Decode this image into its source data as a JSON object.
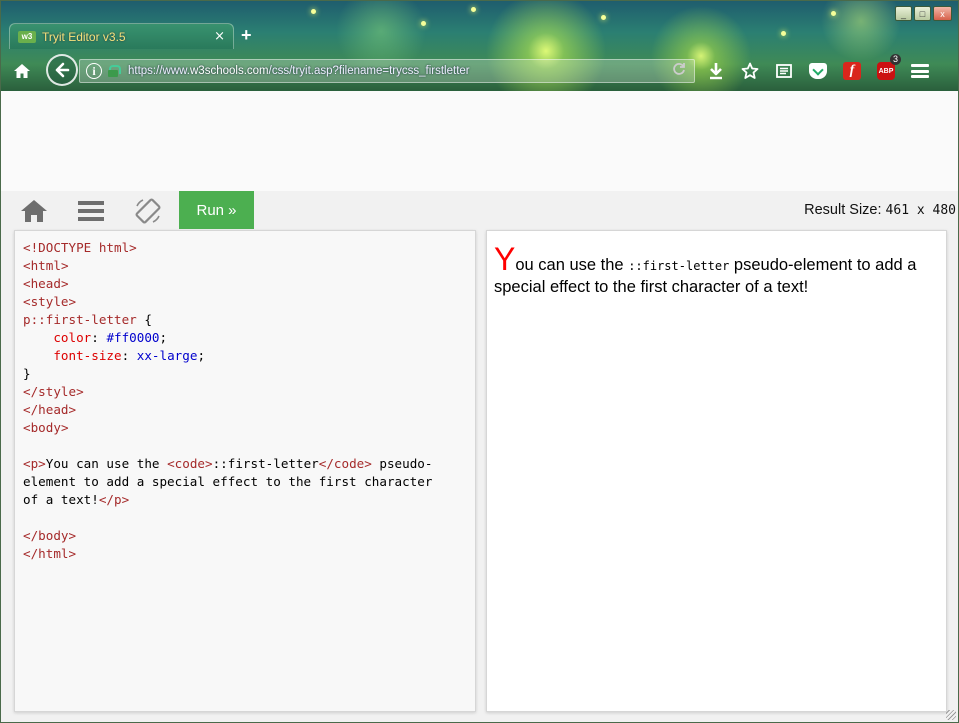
{
  "browser": {
    "tab_title": "Tryit Editor v3.5",
    "tab_favicon": "w3",
    "tab_close": "×",
    "new_tab": "+",
    "url_prefix": "https://www.",
    "url_domain": "w3schools.com",
    "url_path": "/css/tryit.asp?filename=trycss_firstletter",
    "abp_label": "ABP",
    "abp_badge": "3",
    "window_controls": {
      "minimize": "_",
      "maximize": "□",
      "close": "x"
    }
  },
  "toolbar": {
    "run_label": "Run »",
    "result_size_label": "Result Size:",
    "result_size_value": "461 x 480",
    "accent_color": "#4caf50"
  },
  "code": {
    "lines": [
      [
        [
          "tag",
          "<!DOCTYPE html>"
        ]
      ],
      [
        [
          "tag",
          "<"
        ],
        [
          "tagname",
          "html"
        ],
        [
          "tag",
          ">"
        ]
      ],
      [
        [
          "tag",
          "<"
        ],
        [
          "tagname",
          "head"
        ],
        [
          "tag",
          ">"
        ]
      ],
      [
        [
          "tag",
          "<"
        ],
        [
          "tagname",
          "style"
        ],
        [
          "tag",
          ">"
        ]
      ],
      [
        [
          "sel",
          "p::first-letter"
        ],
        [
          "txt",
          " {"
        ]
      ],
      [
        [
          "txt",
          "    "
        ],
        [
          "prop",
          "color"
        ],
        [
          "txt",
          ": "
        ],
        [
          "val",
          "#ff0000"
        ],
        [
          "txt",
          ";"
        ]
      ],
      [
        [
          "txt",
          "    "
        ],
        [
          "prop",
          "font-size"
        ],
        [
          "txt",
          ": "
        ],
        [
          "val",
          "xx-large"
        ],
        [
          "txt",
          ";"
        ]
      ],
      [
        [
          "txt",
          "}"
        ]
      ],
      [
        [
          "tag",
          "</"
        ],
        [
          "tagname",
          "style"
        ],
        [
          "tag",
          ">"
        ]
      ],
      [
        [
          "tag",
          "</"
        ],
        [
          "tagname",
          "head"
        ],
        [
          "tag",
          ">"
        ]
      ],
      [
        [
          "tag",
          "<"
        ],
        [
          "tagname",
          "body"
        ],
        [
          "tag",
          ">"
        ]
      ],
      [
        [
          "txt",
          ""
        ]
      ],
      [
        [
          "tag",
          "<p>"
        ],
        [
          "txt",
          "You can use the "
        ],
        [
          "tag",
          "<code>"
        ],
        [
          "txt",
          "::first-letter"
        ],
        [
          "tag",
          "</code>"
        ],
        [
          "txt",
          " pseudo-"
        ]
      ],
      [
        [
          "txt",
          "element to add a special effect to the first character"
        ]
      ],
      [
        [
          "txt",
          "of a text!"
        ],
        [
          "tag",
          "</p>"
        ]
      ],
      [
        [
          "txt",
          ""
        ]
      ],
      [
        [
          "tag",
          "</"
        ],
        [
          "tagname",
          "body"
        ],
        [
          "tag",
          ">"
        ]
      ],
      [
        [
          "tag",
          "</"
        ],
        [
          "tagname",
          "html"
        ],
        [
          "tag",
          ">"
        ]
      ]
    ]
  },
  "result": {
    "first_letter": "Y",
    "text_before_code": "ou can use the ",
    "code_text": "::first-letter",
    "text_after_code": " pseudo-element to add a special effect to the first character of a text!",
    "first_letter_color": "#ff0000"
  }
}
